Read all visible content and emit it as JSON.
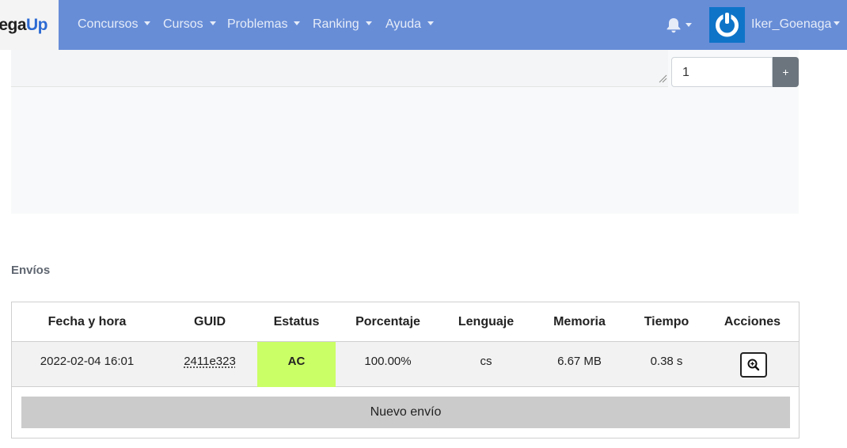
{
  "brand": {
    "part1": "nega",
    "part2": "Up"
  },
  "nav": {
    "items": [
      {
        "label": "Concursos"
      },
      {
        "label": "Cursos"
      },
      {
        "label": "Problemas"
      },
      {
        "label": "Ranking"
      },
      {
        "label": "Ayuda"
      }
    ],
    "user_name": "Iker_Goenaga"
  },
  "editor": {
    "number_label": "1",
    "add_button_label": "+"
  },
  "submissions": {
    "title": "Envíos",
    "headers": [
      "Fecha y hora",
      "GUID",
      "Estatus",
      "Porcentaje",
      "Lenguaje",
      "Memoria",
      "Tiempo",
      "Acciones"
    ],
    "rows": [
      {
        "datetime": "2022-02-04 16:01",
        "guid": "2411e323",
        "status": "AC",
        "percentage": "100.00%",
        "language": "cs",
        "memory": "6.67 MB",
        "time": "0.38 s"
      }
    ],
    "new_button_label": "Nuevo envío"
  },
  "colors": {
    "navbar": "#678dd7",
    "status_ac": "#cbff66",
    "avatar_bg": "#0e74c8"
  },
  "icons": {
    "bell": "bell-icon",
    "avatar": "power-icon",
    "action": "zoom-in-icon"
  }
}
